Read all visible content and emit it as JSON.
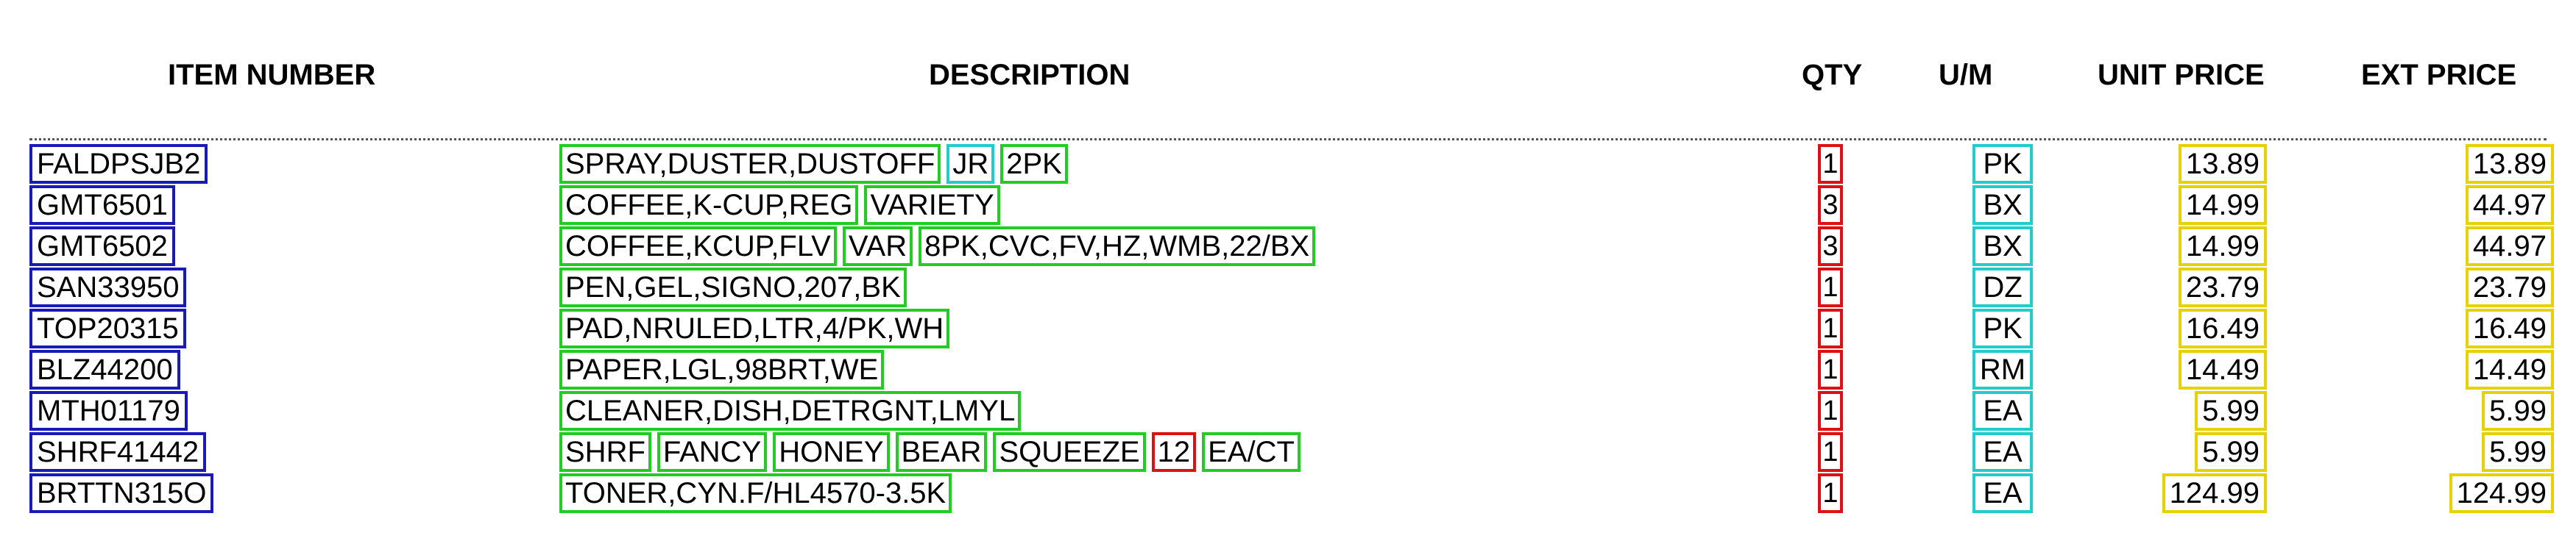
{
  "headers": {
    "item_number": "ITEM NUMBER",
    "description": "DESCRIPTION",
    "qty": "QTY",
    "um": "U/M",
    "unit_price": "UNIT PRICE",
    "ext_price": "EXT PRICE"
  },
  "rows": [
    {
      "item": "FALDPSJB2",
      "desc": [
        "SPRAY,DUSTER,DUSTOFF",
        "JR",
        "2PK"
      ],
      "qty": "1",
      "um": "PK",
      "unit": "13.89",
      "ext": "13.89"
    },
    {
      "item": "GMT6501",
      "desc": [
        "COFFEE,K-CUP,REG",
        "VARIETY"
      ],
      "qty": "3",
      "um": "BX",
      "unit": "14.99",
      "ext": "44.97"
    },
    {
      "item": "GMT6502",
      "desc": [
        "COFFEE,KCUP,FLV",
        "VAR",
        "8PK,CVC,FV,HZ,WMB,22/BX"
      ],
      "qty": "3",
      "um": "BX",
      "unit": "14.99",
      "ext": "44.97"
    },
    {
      "item": "SAN33950",
      "desc": [
        "PEN,GEL,SIGNO,207,BK"
      ],
      "qty": "1",
      "um": "DZ",
      "unit": "23.79",
      "ext": "23.79"
    },
    {
      "item": "TOP20315",
      "desc": [
        "PAD,NRULED,LTR,4/PK,WH"
      ],
      "qty": "1",
      "um": "PK",
      "unit": "16.49",
      "ext": "16.49"
    },
    {
      "item": "BLZ44200",
      "desc": [
        "PAPER,LGL,98BRT,WE"
      ],
      "qty": "1",
      "um": "RM",
      "unit": "14.49",
      "ext": "14.49"
    },
    {
      "item": "MTH01179",
      "desc": [
        "CLEANER,DISH,DETRGNT,LMYL"
      ],
      "qty": "1",
      "um": "EA",
      "unit": "5.99",
      "ext": "5.99"
    },
    {
      "item": "SHRF41442",
      "desc": [
        "SHRF",
        "FANCY",
        "HONEY",
        "BEAR",
        "SQUEEZE",
        "12",
        "EA/CT"
      ],
      "qty": "1",
      "um": "EA",
      "unit": "5.99",
      "ext": "5.99"
    },
    {
      "item": "BRTTN315O",
      "desc": [
        "TONER,CYN.F/HL4570-3.5K"
      ],
      "qty": "1",
      "um": "EA",
      "unit": "124.99",
      "ext": "124.99"
    }
  ],
  "colors": {
    "item_box": "#1a1ab8",
    "desc_box": "#22cc22",
    "qty_box": "#dd1111",
    "um_box": "#22cccc",
    "price_box": "#e6d200"
  }
}
